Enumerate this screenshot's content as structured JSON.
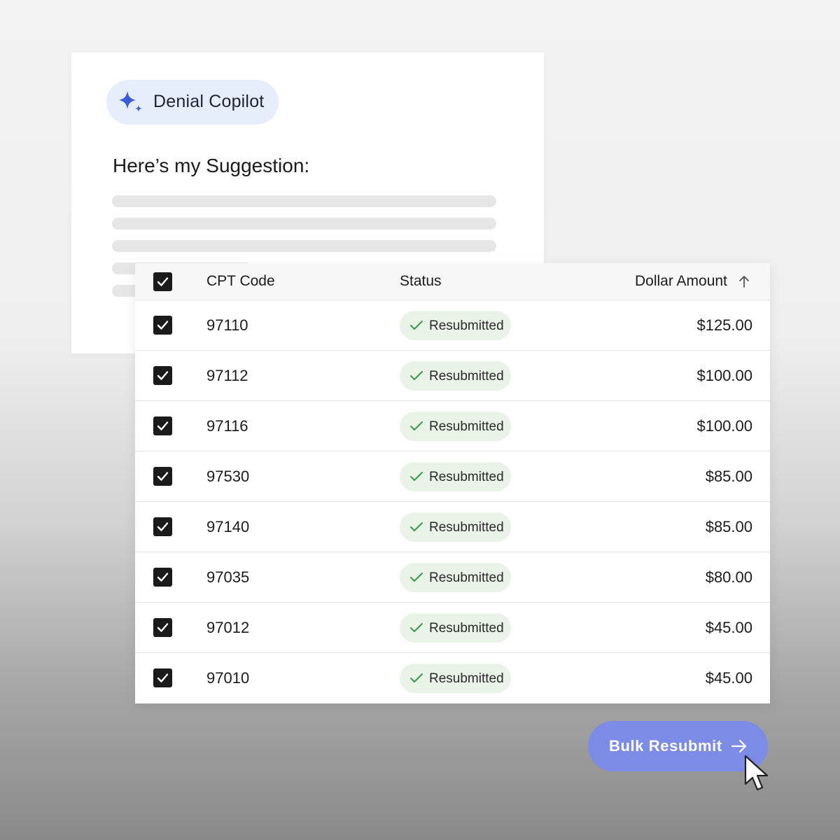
{
  "copilot": {
    "title": "Denial Copilot",
    "heading": "Here’s my Suggestion:",
    "accent_color": "#3b5bdb",
    "icon": "sparkle-icon"
  },
  "table": {
    "headers": {
      "cpt": "CPT Code",
      "status": "Status",
      "amount": "Dollar Amount",
      "sort_icon": "arrow-up-icon"
    },
    "select_all_checked": true,
    "rows": [
      {
        "cpt": "97110",
        "status": "Resubmitted",
        "amount": "$125.00",
        "checked": true
      },
      {
        "cpt": "97112",
        "status": "Resubmitted",
        "amount": "$100.00",
        "checked": true
      },
      {
        "cpt": "97116",
        "status": "Resubmitted",
        "amount": "$100.00",
        "checked": true
      },
      {
        "cpt": "97530",
        "status": "Resubmitted",
        "amount": "$85.00",
        "checked": true
      },
      {
        "cpt": "97140",
        "status": "Resubmitted",
        "amount": "$85.00",
        "checked": true
      },
      {
        "cpt": "97035",
        "status": "Resubmitted",
        "amount": "$80.00",
        "checked": true
      },
      {
        "cpt": "97012",
        "status": "Resubmitted",
        "amount": "$45.00",
        "checked": true
      },
      {
        "cpt": "97010",
        "status": "Resubmitted",
        "amount": "$45.00",
        "checked": true
      }
    ],
    "status_color": "#3a9a4a",
    "badge_bg": "#e9f3e8"
  },
  "actions": {
    "bulk_label": "Bulk Resubmit",
    "bulk_color": "#7c8be6",
    "bulk_icon": "arrow-right-icon",
    "cursor_icon": "mouse-pointer-icon"
  }
}
